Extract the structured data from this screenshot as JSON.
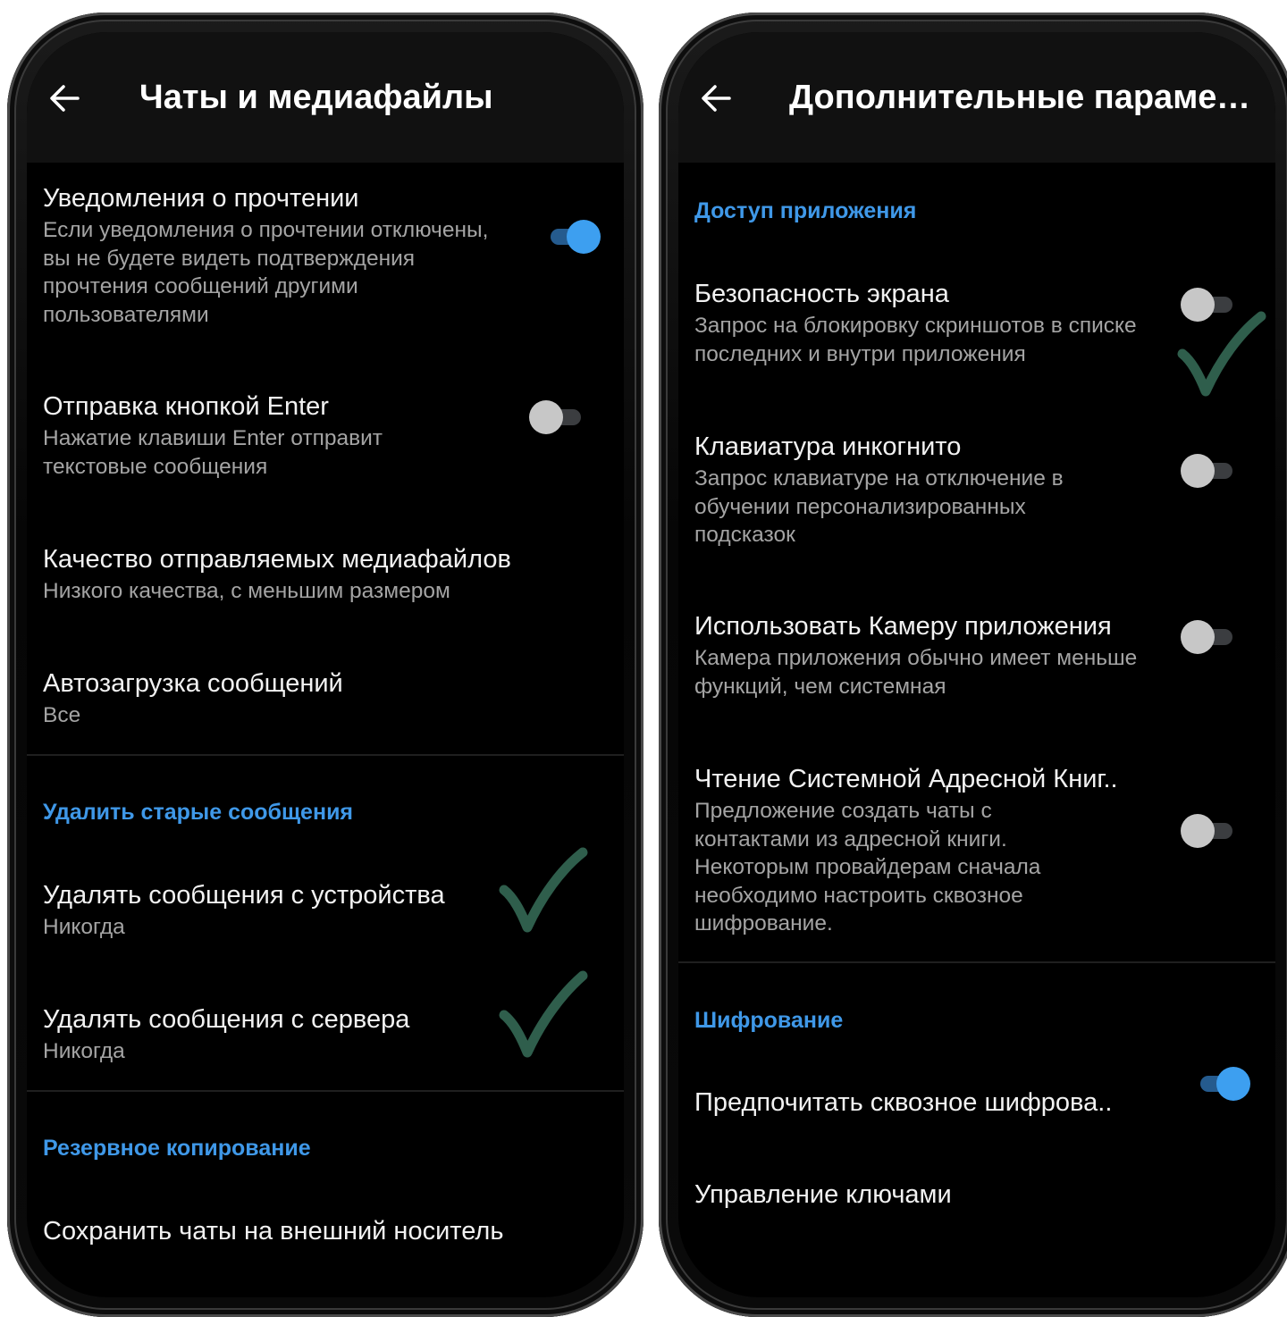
{
  "left": {
    "title": "Чаты и медиафайлы",
    "items": [
      {
        "title": "Уведомления о прочтении",
        "subtitle": "Если уведомления о прочтении отключены, вы не будете видеть подтверждения прочтения сообщений другими пользователями",
        "toggle": "on"
      },
      {
        "title": "Отправка кнопкой Enter",
        "subtitle": "Нажатие клавиши Enter отправит текстовые сообщения",
        "toggle": "off"
      },
      {
        "title": "Качество отправляемых медиафайлов",
        "subtitle": "Низкого качества, с меньшим размером"
      },
      {
        "title": "Автозагрузка сообщений",
        "subtitle": "Все"
      },
      {
        "title": "Удалять сообщения с устройства",
        "subtitle": "Никогда"
      },
      {
        "title": "Удалять сообщения с сервера",
        "subtitle": "Никогда"
      },
      {
        "title": "Сохранить чаты на внешний носитель"
      }
    ],
    "sections": [
      "Удалить старые сообщения",
      "Резервное копирование"
    ]
  },
  "right": {
    "title": "Дополнительные парамет...",
    "sections": [
      "Доступ приложения",
      "Шифрование"
    ],
    "items": [
      {
        "title": "Безопасность экрана",
        "subtitle": "Запрос на блокировку скриншотов в списке последних и внутри приложения",
        "toggle": "off"
      },
      {
        "title": "Клавиатура инкогнито",
        "subtitle": "Запрос клавиатуре на отключение в обучении персонализированных подсказок",
        "toggle": "off"
      },
      {
        "title": "Использовать Камеру приложения",
        "subtitle": "Камера приложения обычно имеет меньше функций, чем системная",
        "toggle": "off"
      },
      {
        "title": "Чтение Системной Адресной Книг..",
        "subtitle": "Предложение создать чаты с контактами из адресной книги. Некоторым провайдерам сначала необходимо настроить сквозное шифрование.",
        "toggle": "off"
      },
      {
        "title": "Предпочитать сквозное шифрова..",
        "toggle": "on"
      },
      {
        "title": "Управление ключами"
      }
    ]
  },
  "colors": {
    "accent": "#3f98e8",
    "background": "#000000",
    "appbar": "#111111",
    "check": "#2f5e4c"
  },
  "icons": {
    "back": "arrow-left-icon",
    "check": "checkmark-icon"
  }
}
